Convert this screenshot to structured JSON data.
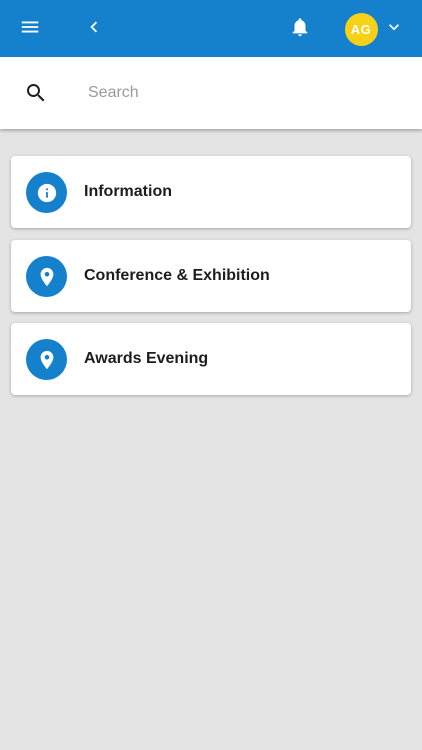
{
  "header": {
    "menu_icon": "menu-icon",
    "back_icon": "chevron-left-icon",
    "bell_icon": "bell-icon",
    "avatar_initials": "AG",
    "avatar_color": "#f7d117",
    "dropdown_icon": "chevron-down-icon",
    "bar_color": "#1580cb"
  },
  "search": {
    "placeholder": "Search",
    "value": "",
    "icon": "search-icon"
  },
  "items": [
    {
      "label": "Information",
      "icon": "info-icon"
    },
    {
      "label": "Conference & Exhibition",
      "icon": "location-pin-icon"
    },
    {
      "label": "Awards Evening",
      "icon": "location-pin-icon"
    }
  ]
}
